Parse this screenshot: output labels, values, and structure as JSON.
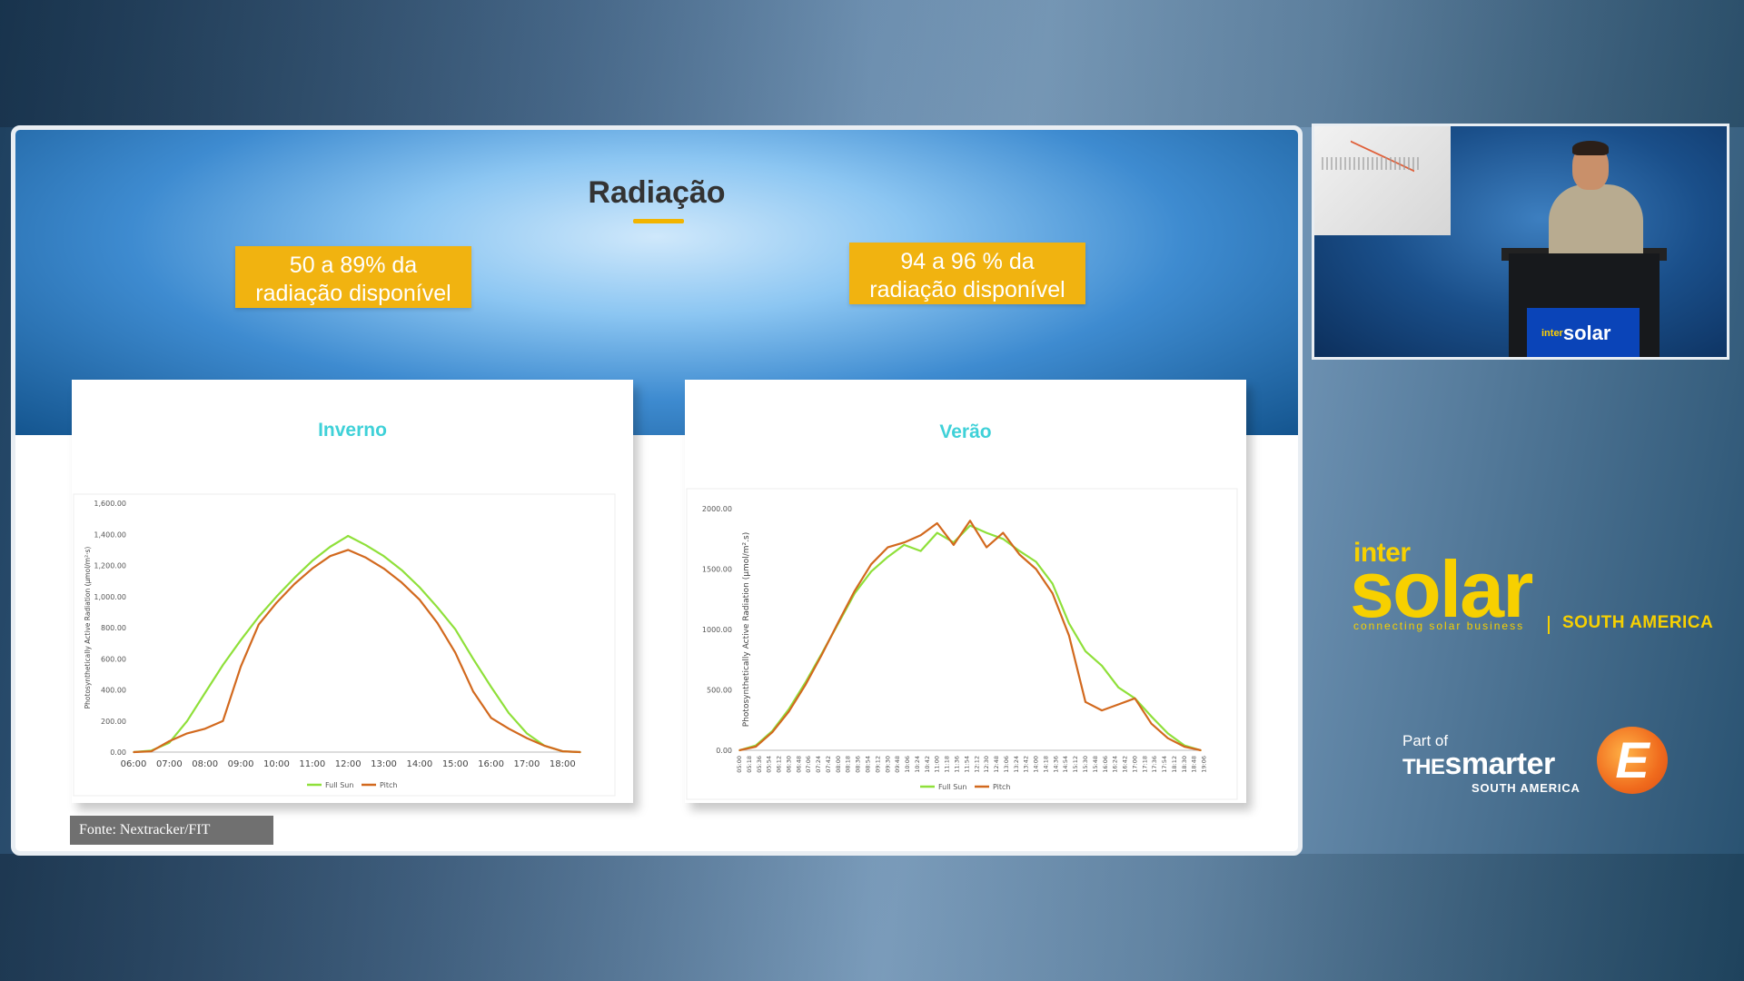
{
  "slide": {
    "title": "Radiação",
    "callouts": {
      "left": "50 a 89% da radiação disponível",
      "right": "94 a 96 % da radiação disponível"
    },
    "source_note": "Fonte: Nextracker/FIT"
  },
  "colors": {
    "callout": "#f1b310",
    "panel_title": "#3fd1d8",
    "full_sun": "#8fe03a",
    "pitch": "#d2691e"
  },
  "chart_data": [
    {
      "type": "line",
      "title": "Inverno",
      "ylabel": "Photosynthetically Active Radiation (μmol/m²·s)",
      "ylim": [
        0,
        1600
      ],
      "yticks": [
        "0.00",
        "200.00",
        "400.00",
        "600.00",
        "800.00",
        "1,000.00",
        "1,200.00",
        "1,400.00",
        "1,600.00"
      ],
      "xticks": [
        "06:00",
        "07:00",
        "08:00",
        "09:00",
        "10:00",
        "11:00",
        "12:00",
        "13:00",
        "14:00",
        "15:00",
        "16:00",
        "17:00",
        "18:00"
      ],
      "legend": [
        "Full Sun",
        "Pitch"
      ],
      "x": [
        "06:00",
        "06:30",
        "07:00",
        "07:30",
        "08:00",
        "08:30",
        "09:00",
        "09:30",
        "10:00",
        "10:30",
        "11:00",
        "11:30",
        "12:00",
        "12:30",
        "13:00",
        "13:30",
        "14:00",
        "14:30",
        "15:00",
        "15:30",
        "16:00",
        "16:30",
        "17:00",
        "17:30",
        "18:00",
        "18:30"
      ],
      "series": [
        {
          "name": "Full Sun",
          "values": [
            0,
            10,
            60,
            200,
            380,
            560,
            720,
            870,
            1000,
            1120,
            1230,
            1320,
            1390,
            1330,
            1260,
            1170,
            1060,
            930,
            790,
            600,
            420,
            250,
            120,
            40,
            5,
            0
          ]
        },
        {
          "name": "Pitch",
          "values": [
            0,
            5,
            70,
            120,
            150,
            200,
            550,
            820,
            960,
            1080,
            1180,
            1260,
            1300,
            1250,
            1180,
            1090,
            980,
            830,
            640,
            390,
            220,
            150,
            90,
            40,
            5,
            0
          ]
        }
      ]
    },
    {
      "type": "line",
      "title": "Verão",
      "ylabel": "Photosynthetically Active Radiation (μmol/m².s)",
      "ylim": [
        0,
        2000
      ],
      "yticks": [
        "0.00",
        "500.00",
        "1000.00",
        "1500.00",
        "2000.00"
      ],
      "xticks": [
        "05:00",
        "05:18",
        "05:36",
        "05:54",
        "06:12",
        "06:30",
        "06:48",
        "07:06",
        "07:24",
        "07:42",
        "08:00",
        "08:18",
        "08:36",
        "08:54",
        "09:12",
        "09:30",
        "09:48",
        "10:06",
        "10:24",
        "10:42",
        "11:00",
        "11:18",
        "11:36",
        "11:54",
        "12:12",
        "12:30",
        "12:48",
        "13:06",
        "13:24",
        "13:42",
        "14:00",
        "14:18",
        "14:36",
        "14:54",
        "15:12",
        "15:30",
        "15:48",
        "16:06",
        "16:24",
        "16:42",
        "17:00",
        "17:18",
        "17:36",
        "17:54",
        "18:12",
        "18:30",
        "18:48",
        "19:06"
      ],
      "legend": [
        "Full Sun",
        "Pitch"
      ],
      "x": [
        "05:00",
        "05:30",
        "06:00",
        "06:30",
        "07:00",
        "07:30",
        "08:00",
        "08:30",
        "09:00",
        "09:30",
        "10:00",
        "10:30",
        "11:00",
        "11:30",
        "12:00",
        "12:30",
        "13:00",
        "13:30",
        "14:00",
        "14:30",
        "15:00",
        "15:30",
        "16:00",
        "16:30",
        "17:00",
        "17:30",
        "18:00",
        "18:30",
        "19:00"
      ],
      "series": [
        {
          "name": "Full Sun",
          "values": [
            0,
            40,
            160,
            340,
            560,
            800,
            1050,
            1300,
            1480,
            1600,
            1700,
            1650,
            1800,
            1720,
            1860,
            1800,
            1750,
            1650,
            1560,
            1380,
            1050,
            820,
            700,
            520,
            430,
            280,
            140,
            40,
            0
          ]
        },
        {
          "name": "Pitch",
          "values": [
            0,
            30,
            150,
            320,
            540,
            790,
            1060,
            1320,
            1540,
            1680,
            1720,
            1780,
            1880,
            1700,
            1900,
            1680,
            1800,
            1620,
            1500,
            1300,
            950,
            400,
            330,
            380,
            430,
            220,
            100,
            30,
            0
          ]
        }
      ]
    }
  ],
  "branding": {
    "intersolar_prefix": "inter",
    "intersolar_name": "solar",
    "tagline": "connecting solar business",
    "region": "SOUTH AMERICA",
    "part_of": "Part of",
    "smarter_the": "THE",
    "smarter_name": "smarter",
    "smarter_region": "SOUTH AMERICA",
    "smarter_letter": "E"
  },
  "video": {
    "podium_brand": "solar",
    "podium_prefix": "inter"
  }
}
